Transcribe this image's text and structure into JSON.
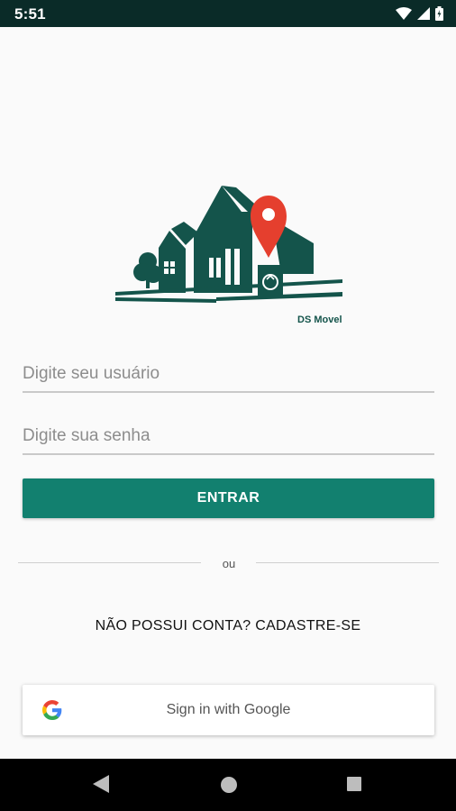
{
  "status_bar": {
    "time": "5:51",
    "icons": [
      "wifi-icon",
      "signal-icon",
      "battery-icon"
    ]
  },
  "logo": {
    "caption": "DS Movel",
    "colors": {
      "house": "#14544b",
      "pin": "#e53f2e"
    }
  },
  "login": {
    "user_placeholder": "Digite seu usuário",
    "user_value": "",
    "password_placeholder": "Digite sua senha",
    "password_value": "",
    "enter_label": "ENTRAR",
    "divider_text": "ou",
    "signup_label": "NÃO POSSUI CONTA? CADASTRE-SE",
    "google_label": "Sign in with Google"
  },
  "nav_bar": {
    "icons": [
      "back-icon",
      "home-icon",
      "recents-icon"
    ]
  },
  "colors": {
    "accent": "#12806f",
    "status_bar": "#0a2b28",
    "background": "#fafafa"
  }
}
